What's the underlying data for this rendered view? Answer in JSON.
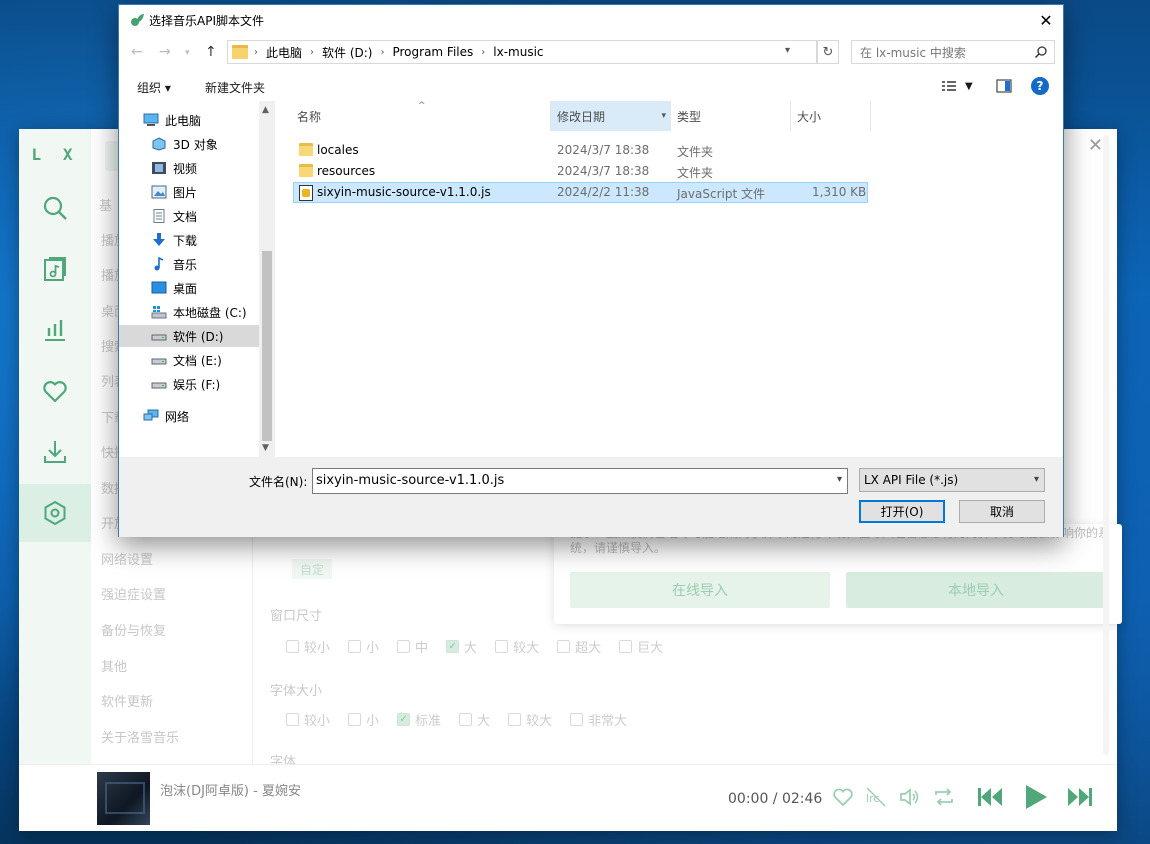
{
  "dialog": {
    "title": "选择音乐API脚本文件",
    "address": [
      "此电脑",
      "软件 (D:)",
      "Program Files",
      "lx-music"
    ],
    "search_placeholder": "在 lx-music 中搜索",
    "toolbar": {
      "organize": "组织 ▾",
      "new_folder": "新建文件夹"
    },
    "tree": [
      {
        "label": "此电脑",
        "icon": "computer-icon"
      },
      {
        "label": "3D 对象",
        "icon": "cube-icon"
      },
      {
        "label": "视频",
        "icon": "video-icon"
      },
      {
        "label": "图片",
        "icon": "picture-icon"
      },
      {
        "label": "文档",
        "icon": "document-icon"
      },
      {
        "label": "下载",
        "icon": "download-icon"
      },
      {
        "label": "音乐",
        "icon": "music-icon"
      },
      {
        "label": "桌面",
        "icon": "desktop-icon"
      },
      {
        "label": "本地磁盘 (C:)",
        "icon": "windows-drive-icon"
      },
      {
        "label": "软件 (D:)",
        "icon": "drive-icon"
      },
      {
        "label": "文档 (E:)",
        "icon": "drive-icon"
      },
      {
        "label": "娱乐 (F:)",
        "icon": "drive-icon"
      },
      {
        "label": "网络",
        "icon": "network-icon"
      }
    ],
    "columns": {
      "name": "名称",
      "date": "修改日期",
      "type": "类型",
      "size": "大小"
    },
    "files": [
      {
        "name": "locales",
        "date": "2024/3/7 18:38",
        "type": "文件夹",
        "size": ""
      },
      {
        "name": "resources",
        "date": "2024/3/7 18:38",
        "type": "文件夹",
        "size": ""
      },
      {
        "name": "sixyin-music-source-v1.1.0.js",
        "date": "2024/2/2 11:38",
        "type": "JavaScript 文件",
        "size": "1,310 KB"
      }
    ],
    "filename_label": "文件名(N):",
    "filename_value": "sixyin-music-source-v1.1.0.js",
    "filetype": "LX API File (*.js)",
    "open_button": "打开(O)",
    "cancel_button": "取消"
  },
  "app": {
    "logo": "L X",
    "settings_nav": [
      "基",
      "播放",
      "播放",
      "桌面",
      "搜索",
      "列表",
      "下载",
      "快捷",
      "数据",
      "开放",
      "网络设置",
      "强迫症设置",
      "备份与恢复",
      "其他",
      "软件更新",
      "关于洛雪音乐"
    ],
    "custom_tag": "自定",
    "modal": {
      "text": "提示：虽然我们已经尽可能地隔离了脚本的运行环境，但导入包含恶意行为的脚本仍可能会影响你的系统，请谨慎导入。",
      "online_import": "在线导入",
      "local_import": "本地导入"
    },
    "window_size": {
      "title": "窗口尺寸",
      "options": [
        "较小",
        "小",
        "中",
        "大",
        "较大",
        "超大",
        "巨大"
      ],
      "selected": "大"
    },
    "font_size": {
      "title": "字体大小",
      "options": [
        "较小",
        "小",
        "标准",
        "大",
        "较大",
        "非常大"
      ],
      "selected": "标准"
    },
    "font_title": "字体",
    "player": {
      "song": "泡沫(DJ阿卓版) - 夏婉安",
      "time": "00:00 / 02:46"
    },
    "accent_color": "#4fa77a"
  }
}
